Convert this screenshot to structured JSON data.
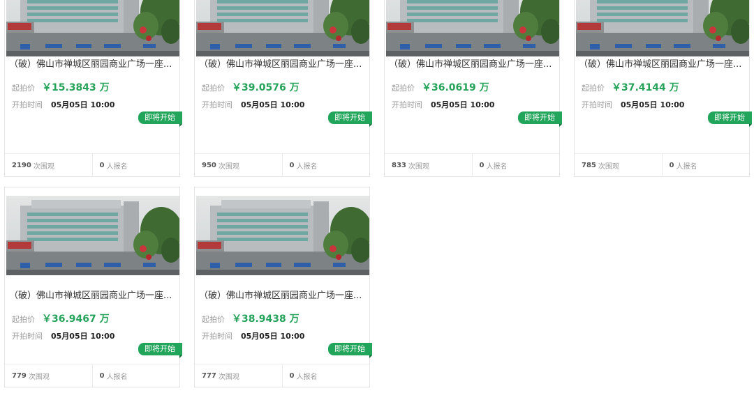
{
  "listings": [
    {
      "title": "（破）佛山市禅城区丽园商业广场一座...",
      "price_label": "起拍价",
      "price": "￥15.3843 万",
      "time_label": "开拍时间",
      "start_time": "05月05日 10:00",
      "status": "即将开始",
      "views": "2190",
      "views_unit": "次围观",
      "signups": "0",
      "signups_unit": "人报名"
    },
    {
      "title": "（破）佛山市禅城区丽园商业广场一座...",
      "price_label": "起拍价",
      "price": "￥39.0576 万",
      "time_label": "开拍时间",
      "start_time": "05月05日 10:00",
      "status": "即将开始",
      "views": "950",
      "views_unit": "次围观",
      "signups": "0",
      "signups_unit": "人报名"
    },
    {
      "title": "（破）佛山市禅城区丽园商业广场一座...",
      "price_label": "起拍价",
      "price": "￥36.0619 万",
      "time_label": "开拍时间",
      "start_time": "05月05日 10:00",
      "status": "即将开始",
      "views": "833",
      "views_unit": "次围观",
      "signups": "0",
      "signups_unit": "人报名"
    },
    {
      "title": "（破）佛山市禅城区丽园商业广场一座...",
      "price_label": "起拍价",
      "price": "￥37.4144 万",
      "time_label": "开拍时间",
      "start_time": "05月05日 10:00",
      "status": "即将开始",
      "views": "785",
      "views_unit": "次围观",
      "signups": "0",
      "signups_unit": "人报名"
    },
    {
      "title": "（破）佛山市禅城区丽园商业广场一座...",
      "price_label": "起拍价",
      "price": "￥36.9467 万",
      "time_label": "开拍时间",
      "start_time": "05月05日 10:00",
      "status": "即将开始",
      "views": "779",
      "views_unit": "次围观",
      "signups": "0",
      "signups_unit": "人报名"
    },
    {
      "title": "（破）佛山市禅城区丽园商业广场一座...",
      "price_label": "起拍价",
      "price": "￥38.9438 万",
      "time_label": "开拍时间",
      "start_time": "05月05日 10:00",
      "status": "即将开始",
      "views": "777",
      "views_unit": "次围观",
      "signups": "0",
      "signups_unit": "人报名"
    }
  ],
  "colors": {
    "price": "#25a35a",
    "badge": "#21a55a"
  },
  "icons": {
    "photo": "building-photo"
  }
}
